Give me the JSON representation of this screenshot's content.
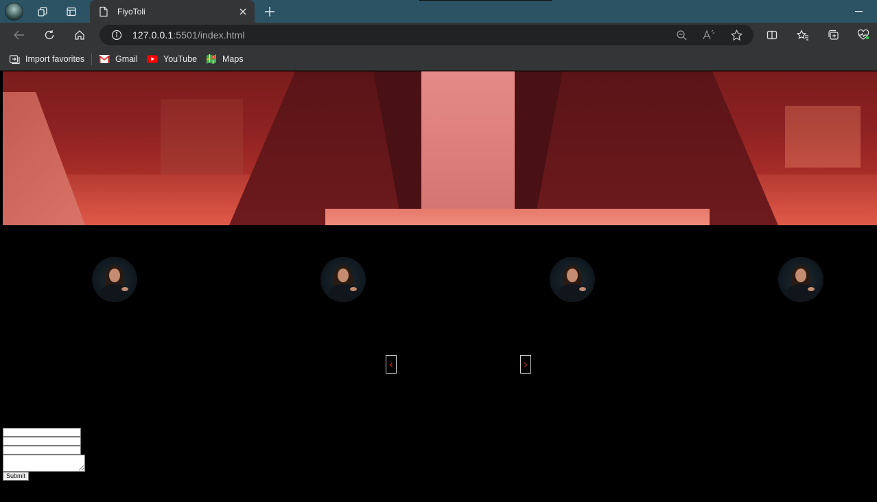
{
  "browser": {
    "tab": {
      "title": "FiyoToli"
    },
    "address": {
      "host": "127.0.0.1",
      "rest": ":5501/index.html"
    },
    "bookmarks": [
      {
        "label": "Import favorites",
        "icon": "import-icon"
      },
      {
        "label": "Gmail",
        "icon": "gmail-icon"
      },
      {
        "label": "YouTube",
        "icon": "youtube-icon"
      },
      {
        "label": "Maps",
        "icon": "maps-icon"
      }
    ]
  },
  "page": {
    "hero": {
      "tint": "#b0302a"
    },
    "avatars": [
      {
        "icon": "woman-portrait"
      },
      {
        "icon": "woman-portrait"
      },
      {
        "icon": "woman-portrait"
      },
      {
        "icon": "woman-portrait"
      }
    ],
    "slider": {
      "prev_label": "‹",
      "next_label": "›"
    },
    "form": {
      "submit_label": "Submit"
    }
  },
  "colors": {
    "titlebar": "#2c5364",
    "toolbar": "#333537",
    "accent_red": "#d42424"
  }
}
